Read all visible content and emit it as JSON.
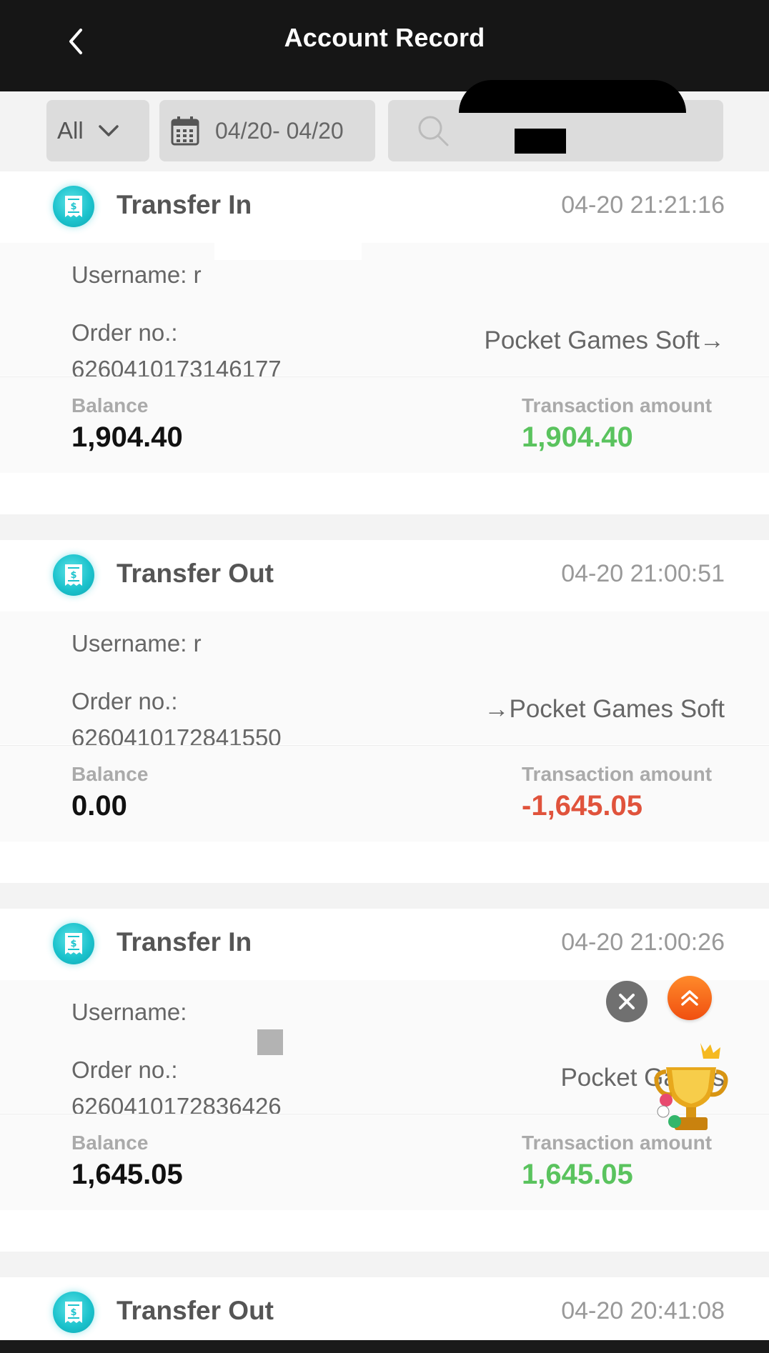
{
  "header": {
    "title": "Account Record",
    "back_icon": "chevron-left-icon"
  },
  "filters": {
    "type_value": "All",
    "date_range": "04/20- 04/20",
    "search_placeholder": ""
  },
  "labels": {
    "username": "Username:",
    "order_no": "Order no.:",
    "balance": "Balance",
    "transaction_amount": "Transaction amount"
  },
  "colors": {
    "positive": "#5ac35e",
    "negative": "#e0533c",
    "accent": "#1cc3cd",
    "header_bg": "#161616"
  },
  "records": [
    {
      "type": "Transfer In",
      "time": "04-20 21:21:16",
      "username": "r",
      "order_no": "6260410173146177",
      "provider": "Pocket Games Soft→",
      "balance": "1,904.40",
      "amount": "1,904.40"
    },
    {
      "type": "Transfer Out",
      "time": "04-20 21:00:51",
      "username": "r",
      "order_no": "6260410172841550",
      "provider": "→Pocket Games Soft",
      "balance": "0.00",
      "amount": "-1,645.05"
    },
    {
      "type": "Transfer In",
      "time": "04-20 21:00:26",
      "username": "",
      "order_no": "6260410172836426",
      "provider": "Pocket Games",
      "balance": "1,645.05",
      "amount": "1,645.05"
    },
    {
      "type": "Transfer Out",
      "time": "04-20 20:41:08"
    }
  ],
  "floating": {
    "close_icon": "close-icon",
    "scroll_top_icon": "double-chevron-up-icon",
    "trophy_icon": "trophy-icon"
  }
}
